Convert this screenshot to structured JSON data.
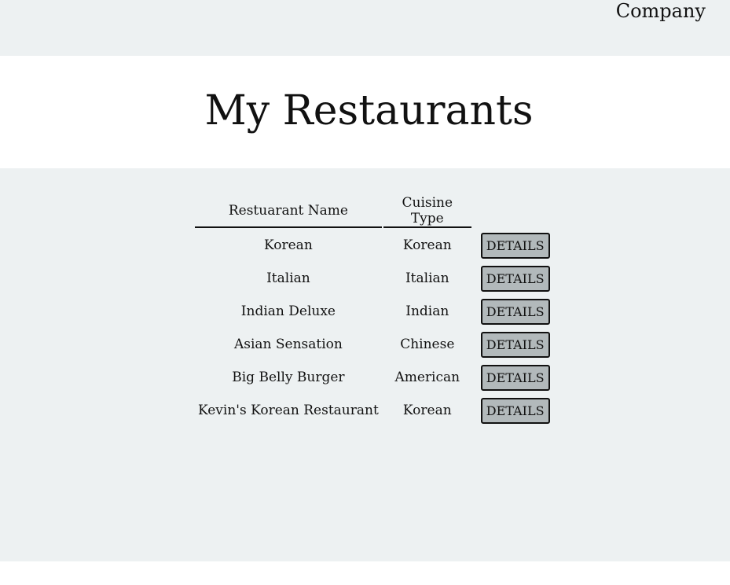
{
  "header": {
    "company_link": "Company"
  },
  "page": {
    "title": "My Restaurants"
  },
  "table": {
    "columns": {
      "name": "Restuarant Name",
      "cuisine": "Cuisine Type",
      "action": ""
    },
    "rows": [
      {
        "name": "Korean",
        "cuisine": "Korean",
        "action": "DETAILS"
      },
      {
        "name": "Italian",
        "cuisine": "Italian",
        "action": "DETAILS"
      },
      {
        "name": "Indian Deluxe",
        "cuisine": "Indian",
        "action": "DETAILS"
      },
      {
        "name": "Asian Sensation",
        "cuisine": "Chinese",
        "action": "DETAILS"
      },
      {
        "name": "Big Belly Burger",
        "cuisine": "American",
        "action": "DETAILS"
      },
      {
        "name": "Kevin's Korean Restaurant",
        "cuisine": "Korean",
        "action": "DETAILS"
      }
    ]
  },
  "colors": {
    "background_gray": "#edf1f2",
    "button_fill": "#b2b9bb",
    "text": "#111111"
  }
}
